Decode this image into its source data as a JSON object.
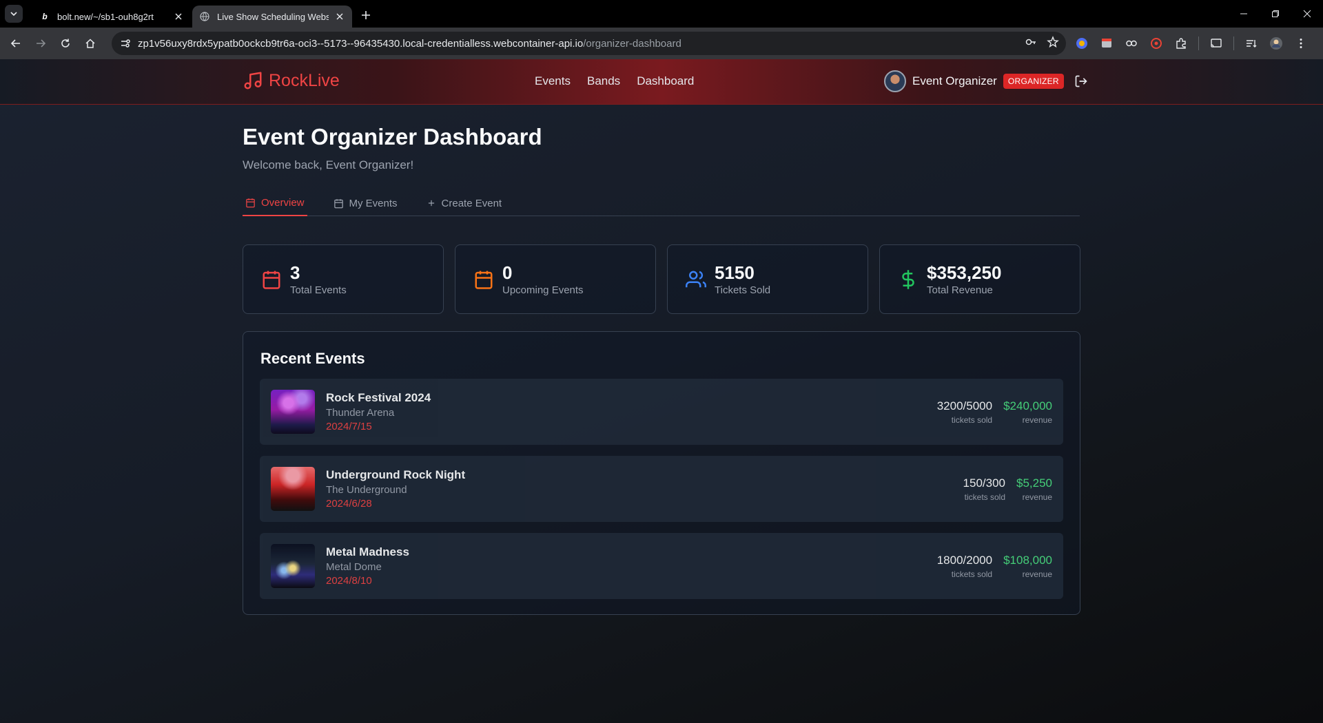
{
  "browser": {
    "tabs": [
      {
        "title": "bolt.new/~/sb1-ouh8g2rt",
        "favicon": "b"
      },
      {
        "title": "Live Show Scheduling Website",
        "active": true
      }
    ],
    "url_host": "zp1v56uxy8rdx5ypatb0ockcb9tr6a-oci3--5173--96435430.local-credentialless.webcontainer-api.io",
    "url_path": "/organizer-dashboard"
  },
  "site": {
    "brand": "RockLive",
    "nav": [
      "Events",
      "Bands",
      "Dashboard"
    ],
    "user": {
      "name": "Event Organizer",
      "role": "ORGANIZER"
    }
  },
  "dashboard": {
    "title": "Event Organizer Dashboard",
    "subtitle": "Welcome back, Event Organizer!",
    "tabs": [
      {
        "label": "Overview",
        "icon": "calendar-icon",
        "active": true
      },
      {
        "label": "My Events",
        "icon": "calendar-icon"
      },
      {
        "label": "Create Event",
        "icon": "plus-icon"
      }
    ],
    "stats": [
      {
        "value": "3",
        "label": "Total Events",
        "icon": "calendar-icon",
        "color": "#ef4444"
      },
      {
        "value": "0",
        "label": "Upcoming Events",
        "icon": "calendar-icon",
        "color": "#f97316"
      },
      {
        "value": "5150",
        "label": "Tickets Sold",
        "icon": "users-icon",
        "color": "#3b82f6"
      },
      {
        "value": "$353,250",
        "label": "Total Revenue",
        "icon": "dollar-icon",
        "color": "#22c55e"
      }
    ],
    "recent_title": "Recent Events",
    "events": [
      {
        "name": "Rock Festival 2024",
        "venue": "Thunder Arena",
        "date": "2024/7/15",
        "tickets": "3200/5000",
        "tickets_label": "tickets sold",
        "revenue": "$240,000",
        "revenue_label": "revenue"
      },
      {
        "name": "Underground Rock Night",
        "venue": "The Underground",
        "date": "2024/6/28",
        "tickets": "150/300",
        "tickets_label": "tickets sold",
        "revenue": "$5,250",
        "revenue_label": "revenue"
      },
      {
        "name": "Metal Madness",
        "venue": "Metal Dome",
        "date": "2024/8/10",
        "tickets": "1800/2000",
        "tickets_label": "tickets sold",
        "revenue": "$108,000",
        "revenue_label": "revenue"
      }
    ]
  }
}
